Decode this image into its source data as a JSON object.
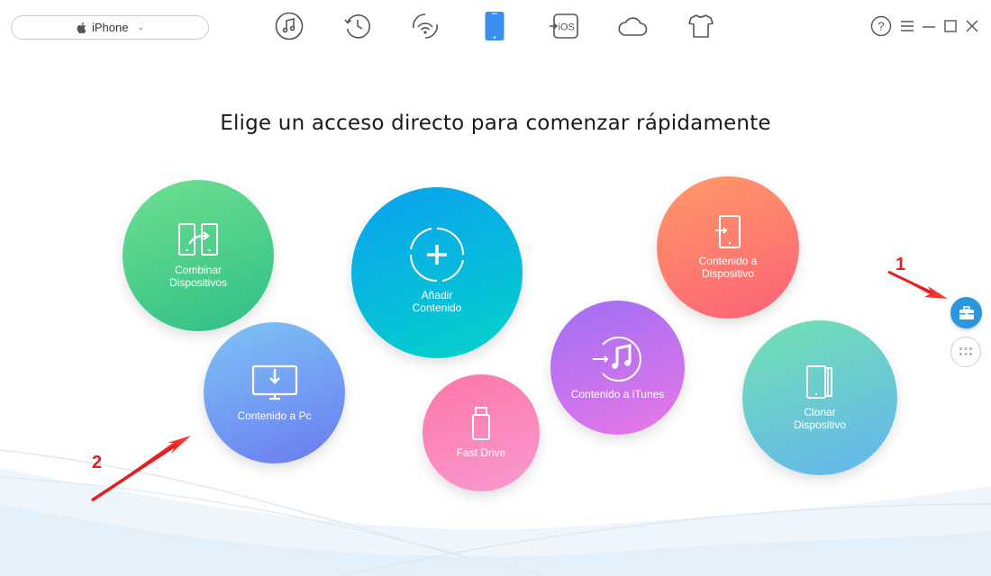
{
  "device_selector": {
    "label": "iPhone",
    "apple_icon": "apple-icon",
    "chevron_icon": "chevron-down-icon"
  },
  "nav": [
    {
      "name": "music",
      "icon": "music-note-icon"
    },
    {
      "name": "history",
      "icon": "clock-history-icon"
    },
    {
      "name": "wifi-sync",
      "icon": "wifi-icon"
    },
    {
      "name": "device",
      "icon": "phone-icon",
      "active": true
    },
    {
      "name": "ios",
      "icon": "ios-icon",
      "text": "iOS"
    },
    {
      "name": "icloud",
      "icon": "cloud-icon"
    },
    {
      "name": "tools",
      "icon": "tshirt-icon"
    }
  ],
  "window_controls": {
    "help": "help-icon",
    "menu": "menu-icon",
    "minimize": "minimize-icon",
    "maximize": "maximize-icon",
    "close": "close-icon"
  },
  "title": "Elige un acceso directo para comenzar rápidamente",
  "shortcuts": {
    "combinar": "Combinar\nDispositivos",
    "anadir": "Añadir\nContenido",
    "contenido_dispositivo": "Contenido a\nDispositivo",
    "contenido_pc": "Contenido a Pc",
    "contenido_itunes": "Contenido a iTunes",
    "fast_drive": "Fast Drive",
    "clonar": "Clonar\nDispositivo"
  },
  "side_buttons": {
    "toolbox": "toolbox-icon",
    "grid": "grid-icon"
  },
  "annotations": {
    "one": "1",
    "two": "2"
  },
  "colors": {
    "accent_blue": "#2b96e0",
    "annotation_red": "#e81e1e",
    "active_nav": "#3a8ef0"
  }
}
